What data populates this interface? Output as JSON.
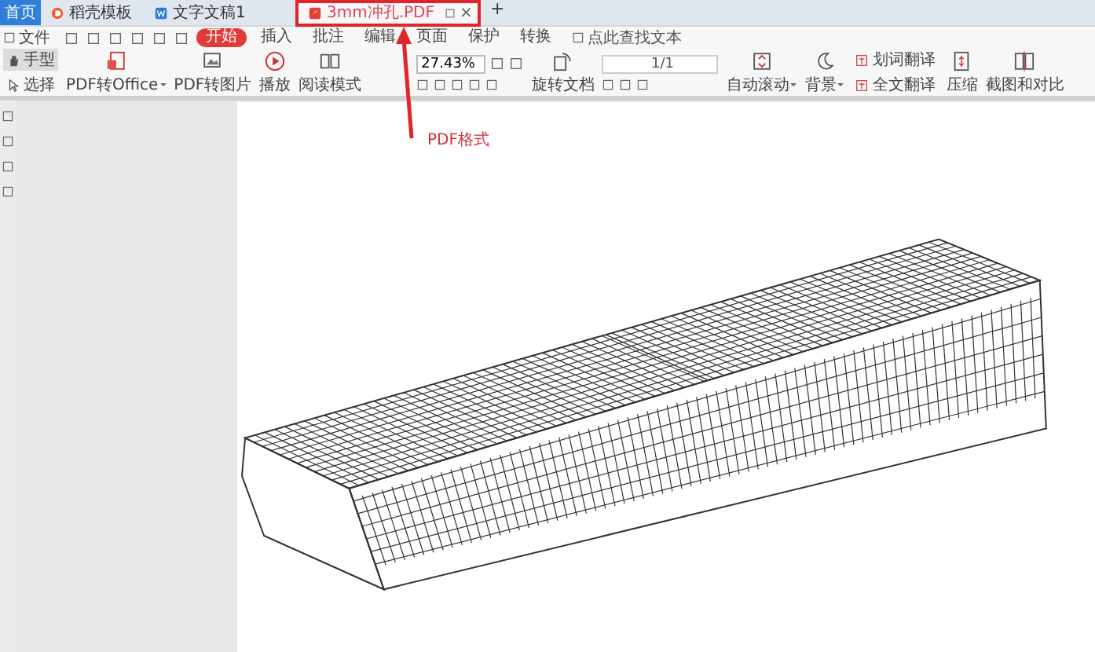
{
  "tabs": [
    {
      "label": "首页",
      "kind": "home",
      "selected": false
    },
    {
      "label": "稻壳模板",
      "kind": "template",
      "selected": false
    },
    {
      "label": "文字文稿1",
      "kind": "doc",
      "selected": false
    },
    {
      "label": "3mm冲孔.PDF",
      "kind": "pdf",
      "selected": true,
      "close": "×"
    }
  ],
  "new_tab": "+",
  "menu": {
    "file": "文件",
    "items": [
      {
        "label": "开始",
        "selected": true
      },
      {
        "label": "插入",
        "selected": false
      },
      {
        "label": "批注",
        "selected": false
      },
      {
        "label": "编辑",
        "selected": false
      },
      {
        "label": "页面",
        "selected": false
      },
      {
        "label": "保护",
        "selected": false
      },
      {
        "label": "转换",
        "selected": false
      }
    ],
    "search": {
      "placeholder": "点此查找文本"
    }
  },
  "toolbar": [
    {
      "kind": "pair",
      "rows": [
        {
          "label": "手型",
          "selected": true
        },
        {
          "label": "选择",
          "selected": false
        }
      ]
    },
    {
      "kind": "big",
      "label": "PDF转Office",
      "dropdown": true
    },
    {
      "kind": "big",
      "label": "PDF转图片",
      "dropdown": false
    },
    {
      "kind": "big",
      "label": "播放",
      "dropdown": false
    },
    {
      "kind": "big",
      "label": "阅读模式",
      "dropdown": false
    },
    {
      "kind": "zoom",
      "value": "27.43%"
    },
    {
      "kind": "big",
      "label": "旋转文档",
      "dropdown": false
    },
    {
      "kind": "pagenav",
      "value": "1/1"
    },
    {
      "kind": "big",
      "label": "自动滚动",
      "dropdown": true
    },
    {
      "kind": "big",
      "label": "背景",
      "dropdown": true
    },
    {
      "kind": "pair",
      "rows": [
        {
          "label": "划词翻译",
          "selected": false
        },
        {
          "label": "全文翻译",
          "selected": false
        }
      ]
    },
    {
      "kind": "big",
      "label": "压缩",
      "dropdown": false
    },
    {
      "kind": "big",
      "label": "截图和对比",
      "dropdown": false
    }
  ],
  "annotation": {
    "label": "PDF格式"
  }
}
